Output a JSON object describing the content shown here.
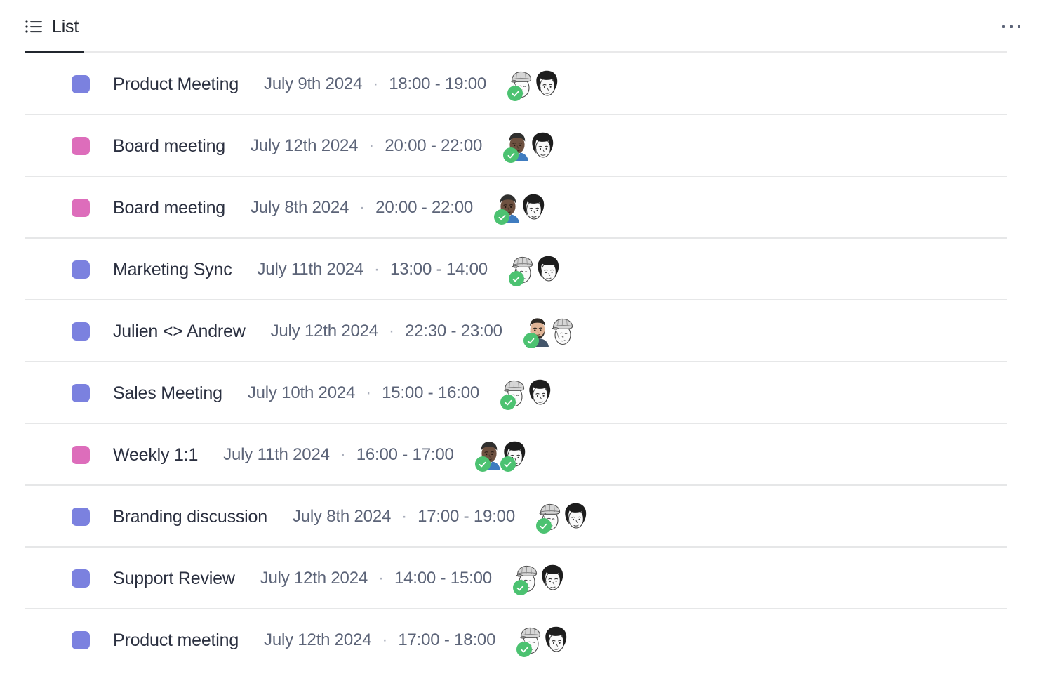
{
  "header": {
    "tab_label": "List",
    "tab_icon": "list-icon",
    "more_icon": "ellipsis-icon"
  },
  "colors": {
    "purple": "#7b81df",
    "pink": "#dd6dbb",
    "check_green": "#4cc271",
    "title_text": "#2b3040",
    "meta_text": "#5c6478",
    "divider": "#e6e7e8",
    "active_tab_underline": "#21262e"
  },
  "list": {
    "separator": "·",
    "time_dash": "-",
    "events": [
      {
        "title": "Product Meeting",
        "date": "July 9th 2024",
        "time": "18:00 - 19:00",
        "color": "#7b81df",
        "attendees": [
          {
            "avatar": "avatar-cap-person",
            "accepted": true
          },
          {
            "avatar": "avatar-dark-hair-person",
            "accepted": false
          }
        ]
      },
      {
        "title": "Board meeting",
        "date": "July 12th 2024",
        "time": "20:00 - 22:00",
        "color": "#dd6dbb",
        "attendees": [
          {
            "avatar": "avatar-blue-shirt-person",
            "accepted": true
          },
          {
            "avatar": "avatar-dark-hair-person",
            "accepted": false
          }
        ]
      },
      {
        "title": "Board meeting",
        "date": "July 8th 2024",
        "time": "20:00 - 22:00",
        "color": "#dd6dbb",
        "attendees": [
          {
            "avatar": "avatar-blue-shirt-person",
            "accepted": true
          },
          {
            "avatar": "avatar-dark-hair-person",
            "accepted": false
          }
        ]
      },
      {
        "title": "Marketing Sync",
        "date": "July 11th 2024",
        "time": "13:00 - 14:00",
        "color": "#7b81df",
        "attendees": [
          {
            "avatar": "avatar-cap-person",
            "accepted": true
          },
          {
            "avatar": "avatar-dark-hair-person",
            "accepted": false
          }
        ]
      },
      {
        "title": "Julien <> Andrew",
        "date": "July 12th 2024",
        "time": "22:30 - 23:00",
        "color": "#7b81df",
        "attendees": [
          {
            "avatar": "avatar-beard-person",
            "accepted": true
          },
          {
            "avatar": "avatar-cap-person",
            "accepted": false
          }
        ]
      },
      {
        "title": "Sales Meeting",
        "date": "July 10th 2024",
        "time": "15:00 - 16:00",
        "color": "#7b81df",
        "attendees": [
          {
            "avatar": "avatar-cap-person",
            "accepted": true
          },
          {
            "avatar": "avatar-dark-hair-person",
            "accepted": false
          }
        ]
      },
      {
        "title": "Weekly 1:1",
        "date": "July 11th 2024",
        "time": "16:00 - 17:00",
        "color": "#dd6dbb",
        "attendees": [
          {
            "avatar": "avatar-blue-shirt-person",
            "accepted": true
          },
          {
            "avatar": "avatar-dark-hair-person",
            "accepted": true
          }
        ]
      },
      {
        "title": "Branding discussion",
        "date": "July 8th 2024",
        "time": "17:00 - 19:00",
        "color": "#7b81df",
        "attendees": [
          {
            "avatar": "avatar-cap-person",
            "accepted": true
          },
          {
            "avatar": "avatar-dark-hair-person",
            "accepted": false
          }
        ]
      },
      {
        "title": "Support Review",
        "date": "July 12th 2024",
        "time": "14:00 - 15:00",
        "color": "#7b81df",
        "attendees": [
          {
            "avatar": "avatar-cap-person",
            "accepted": true
          },
          {
            "avatar": "avatar-dark-hair-person",
            "accepted": false
          }
        ]
      },
      {
        "title": "Product meeting",
        "date": "July 12th 2024",
        "time": "17:00 - 18:00",
        "color": "#7b81df",
        "attendees": [
          {
            "avatar": "avatar-cap-person",
            "accepted": true
          },
          {
            "avatar": "avatar-dark-hair-person",
            "accepted": false
          }
        ]
      }
    ]
  }
}
